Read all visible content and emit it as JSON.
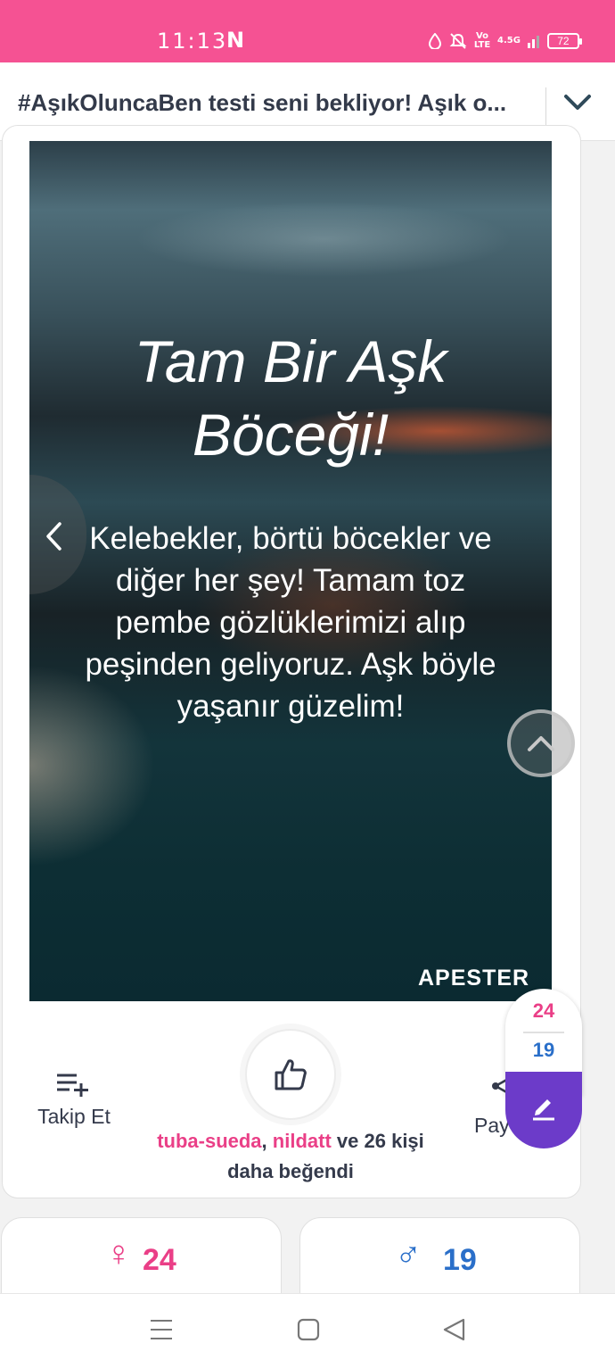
{
  "status_bar": {
    "time": "11:13",
    "notification_icon": "N",
    "network": "4.5G",
    "volte": "Vo LTE",
    "battery": "72",
    "icons": [
      "water-drop-icon",
      "mute-bell-icon",
      "volte-icon",
      "signal-icon",
      "battery-icon"
    ],
    "bg_color": "#f55293"
  },
  "header": {
    "title": "#AşıkOluncaBen testi seni bekliyor! Aşık o..."
  },
  "result": {
    "heading": "Tam Bir Aşk Böceği!",
    "description": "Kelebekler, börtü böcekler ve diğer her şey! Tamam toz pembe gözlüklerimizi alıp peşinden geliyoruz. Aşk böyle yaşanır güzelim!",
    "brand": "APESTER"
  },
  "actions": {
    "follow_label": "Takip Et",
    "share_label": "Pay",
    "likers": [
      "tuba-sueda",
      "nildatt"
    ],
    "likers_separator": ",",
    "likers_suffix": "ve 26 kişi daha beğendi"
  },
  "votes": {
    "up": "24",
    "down": "19",
    "up_color": "#ea3f87",
    "down_color": "#2a6fc9",
    "edit_color": "#6c3bc9"
  },
  "reactions": {
    "female_symbol": "♀",
    "female_count": "24",
    "male_symbol": "♂",
    "male_count": "19"
  },
  "nav_bar": {
    "icons": [
      "menu-icon",
      "home-square-icon",
      "back-triangle-icon"
    ]
  }
}
